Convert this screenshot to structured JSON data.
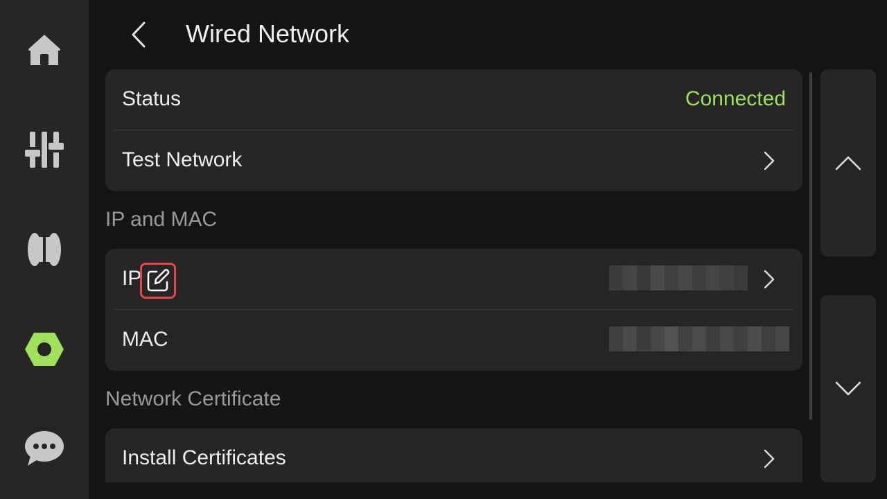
{
  "sidebar": {
    "items": [
      {
        "name": "home-icon",
        "color": "#c8c8c8"
      },
      {
        "name": "sliders-icon",
        "color": "#c8c8c8"
      },
      {
        "name": "filament-spool-icon",
        "color": "#c8c8c8"
      },
      {
        "name": "settings-hexagon-icon",
        "color": "#9ee05a",
        "active": true
      },
      {
        "name": "chat-bubble-icon",
        "color": "#c8c8c8"
      }
    ]
  },
  "header": {
    "title": "Wired Network",
    "back_icon": "chevron-left-icon"
  },
  "status_card": {
    "status_label": "Status",
    "status_value": "Connected",
    "status_color": "#9ee05a",
    "test_label": "Test Network"
  },
  "ip_mac_section": {
    "title": "IP and MAC",
    "ip_label": "IP",
    "mac_label": "MAC"
  },
  "certificate_section": {
    "title": "Network Certificate",
    "install_label": "Install Certificates"
  },
  "scroll_buttons": {
    "up_icon": "chevron-up-icon",
    "down_icon": "chevron-down-icon"
  },
  "colors": {
    "accent": "#9ee05a",
    "highlight_border": "#e8454a",
    "background": "#151515",
    "card": "#262626"
  }
}
